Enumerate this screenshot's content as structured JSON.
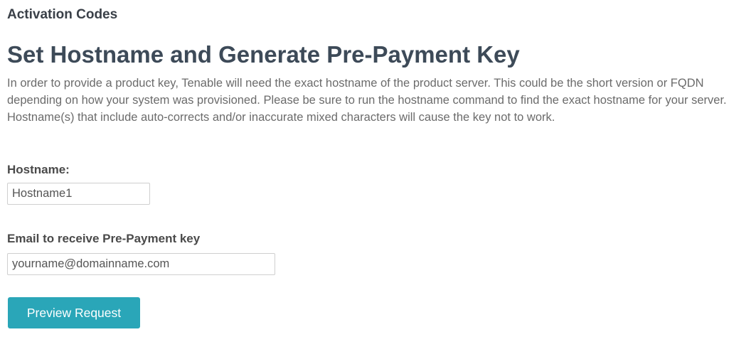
{
  "section": {
    "label": "Activation Codes"
  },
  "form": {
    "title": "Set Hostname and Generate Pre-Payment Key",
    "description": "In order to provide a product key, Tenable will need the exact hostname of the product server. This could be the short version or FQDN depending on how your system was provisioned. Please be sure to run the hostname command to find the exact hostname for your server. Hostname(s) that include auto-corrects and/or inaccurate mixed characters will cause the key not to work.",
    "hostname": {
      "label": "Hostname:",
      "value": "Hostname1"
    },
    "email": {
      "label": "Email to receive Pre-Payment key",
      "value": "yourname@domainname.com"
    },
    "submit_label": "Preview Request"
  },
  "colors": {
    "button_background": "#2aa6b8",
    "title_text": "#3d4a58"
  }
}
